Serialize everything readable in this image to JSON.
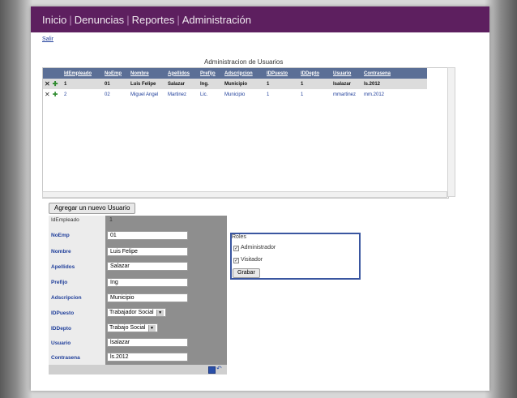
{
  "nav": {
    "items": [
      "Inicio",
      "Denuncias",
      "Reportes",
      "Administración"
    ],
    "separator": "|"
  },
  "salir": "Salir",
  "grid": {
    "title": "Administracion de Usuarios",
    "columns": [
      "IdEmpleado",
      "NoEmp",
      "Nombre",
      "Apellidos",
      "Prefijo",
      "Adscripcion",
      "IDPuesto",
      "IDDepto",
      "Usuario",
      "Contrasena"
    ],
    "rows": [
      [
        "1",
        "01",
        "Luis Felipe",
        "Salazar",
        "Ing.",
        "Municipio",
        "1",
        "1",
        "lsalazar",
        "ls.2012"
      ],
      [
        "2",
        "02",
        "Miguel Angel",
        "Martinez",
        "Lic.",
        "Municipio",
        "1",
        "1",
        "mmartinez",
        "mm.2012"
      ]
    ],
    "selected_row": 0,
    "row_action_icons": [
      "delete-icon",
      "edit-icon"
    ]
  },
  "add_button": "Agregar un nuevo Usuario",
  "form": {
    "idempleado_label": "IdEmpleado",
    "idempleado_value": "1",
    "fields": [
      {
        "label": "NoEmp",
        "value": "01"
      },
      {
        "label": "Nombre",
        "value": "Luis Felipe"
      },
      {
        "label": "Apellidos",
        "value": "Salazar"
      },
      {
        "label": "Prefijo",
        "value": "Ing"
      },
      {
        "label": "Adscripcion",
        "value": "Municipio"
      },
      {
        "label": "IDPuesto",
        "value": "Trabajador Social"
      },
      {
        "label": "IDDepto",
        "value": "Trabajo Social"
      },
      {
        "label": "Usuario",
        "value": "lsalazar"
      },
      {
        "label": "Contrasena",
        "value": "ls.2012"
      }
    ]
  },
  "roles": {
    "title": "Roles",
    "items": [
      {
        "label": "Administrador",
        "checked": true
      },
      {
        "label": "Visitador",
        "checked": true
      }
    ],
    "save_button": "Grabar"
  },
  "colors": {
    "topbar": "#5d1f5f",
    "grid_header": "#5b6f96",
    "link": "#1f3e9a"
  }
}
